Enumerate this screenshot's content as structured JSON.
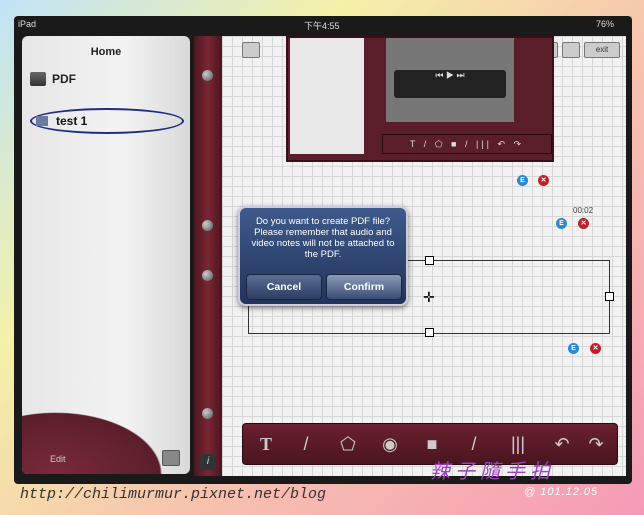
{
  "status_bar": {
    "device": "iPad",
    "time": "下午4:55",
    "battery": "76%"
  },
  "left_panel": {
    "title": "Home",
    "items": [
      {
        "label": "PDF"
      },
      {
        "label": "test 1"
      }
    ],
    "edit_label": "Edit"
  },
  "top_buttons": {
    "exit_label": "exit"
  },
  "audio_note": {
    "time": "00:02"
  },
  "dialog": {
    "message": "Do you want to create PDF file? Please remember that audio and video notes will not be attached to the PDF.",
    "cancel_label": "Cancel",
    "confirm_label": "Confirm"
  },
  "badges": {
    "edit": "E",
    "delete": "✕"
  },
  "info_label": "i",
  "toolbar": {
    "tools": [
      "text-tool-icon",
      "pen-tool-icon",
      "shape-tool-icon",
      "video-tool-icon",
      "rectangle-tool-icon",
      "marker-tool-icon",
      "piano-tool-icon",
      "undo-icon",
      "redo-icon"
    ]
  },
  "watermark": {
    "url": "http://chilimurmur.pixnet.net/blog",
    "signature": "辣子隨手拍",
    "date": "@ 101.12.05"
  }
}
